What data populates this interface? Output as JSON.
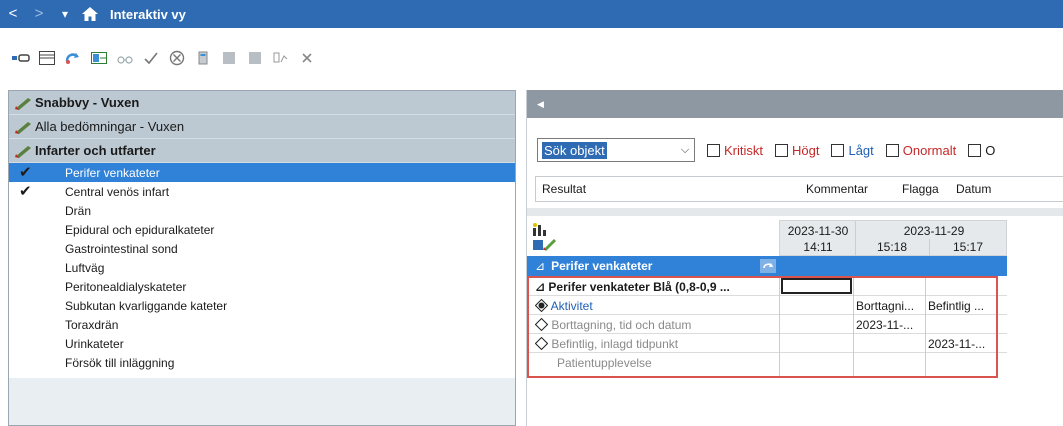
{
  "titlebar": {
    "title": "Interaktiv vy",
    "back": "<",
    "forward": ">",
    "menu": "▾"
  },
  "toolbar": {
    "icons": [
      "link-icon",
      "table-icon",
      "sync-icon",
      "grid-icon",
      "glasses-icon",
      "checkmark-icon",
      "cancel-icon",
      "document-icon",
      "square-icon",
      "square-icon",
      "chart-icon",
      "close-icon"
    ]
  },
  "left": {
    "groups": [
      {
        "label": "Snabbvy - Vuxen"
      },
      {
        "label": "Alla bedömningar - Vuxen"
      },
      {
        "label": "Infarter och utfarter"
      }
    ],
    "items": [
      {
        "label": "Perifer venkateter",
        "checked": "✔"
      },
      {
        "label": "Central venös infart",
        "checked": "✔"
      },
      {
        "label": "Drän",
        "checked": ""
      },
      {
        "label": "Epidural och epiduralkateter",
        "checked": ""
      },
      {
        "label": "Gastrointestinal sond",
        "checked": ""
      },
      {
        "label": "Luftväg",
        "checked": ""
      },
      {
        "label": "Peritonealdialyskateter",
        "checked": ""
      },
      {
        "label": "Subkutan kvarliggande kateter",
        "checked": ""
      },
      {
        "label": "Toraxdrän",
        "checked": ""
      },
      {
        "label": "Urinkateter",
        "checked": ""
      },
      {
        "label": "Försök till inläggning",
        "checked": ""
      }
    ]
  },
  "right": {
    "search": {
      "value": "Sök objekt",
      "dropdown": "⌵"
    },
    "filters": {
      "critical": "Kritiskt",
      "high": "Högt",
      "low": "Lågt",
      "abnormal": "Onormalt",
      "cut": "O"
    },
    "columns": {
      "result": "Resultat",
      "comment": "Kommentar",
      "flag": "Flagga",
      "date": "Datum"
    },
    "dates": {
      "d1": "2023-11-30",
      "d2": "2023-11-29",
      "t1": "14:11",
      "t2": "15:18",
      "t3": "15:17"
    },
    "section": {
      "label": "Perifer venkateter",
      "arrow": "⊿"
    },
    "rows": {
      "r0": {
        "label": "Perifer venkateter Blå (0,8-0,9 ...",
        "arrow": "⊿"
      },
      "r1": {
        "label": "Aktivitet",
        "v2": "Borttagni...",
        "v3": "Befintlig ..."
      },
      "r2": {
        "label": "Borttagning, tid och datum",
        "v2": "2023-11-..."
      },
      "r3": {
        "label": "Befintlig, inlagd tidpunkt",
        "v3": "2023-11-..."
      },
      "r4": {
        "label": "Patientupplevelse"
      }
    }
  },
  "colors": {
    "titlebar": "#2f6bb3",
    "selection": "#2f82d8",
    "highlight_border": "#d9534f",
    "critical": "#c62828",
    "link": "#1f5fb5"
  }
}
